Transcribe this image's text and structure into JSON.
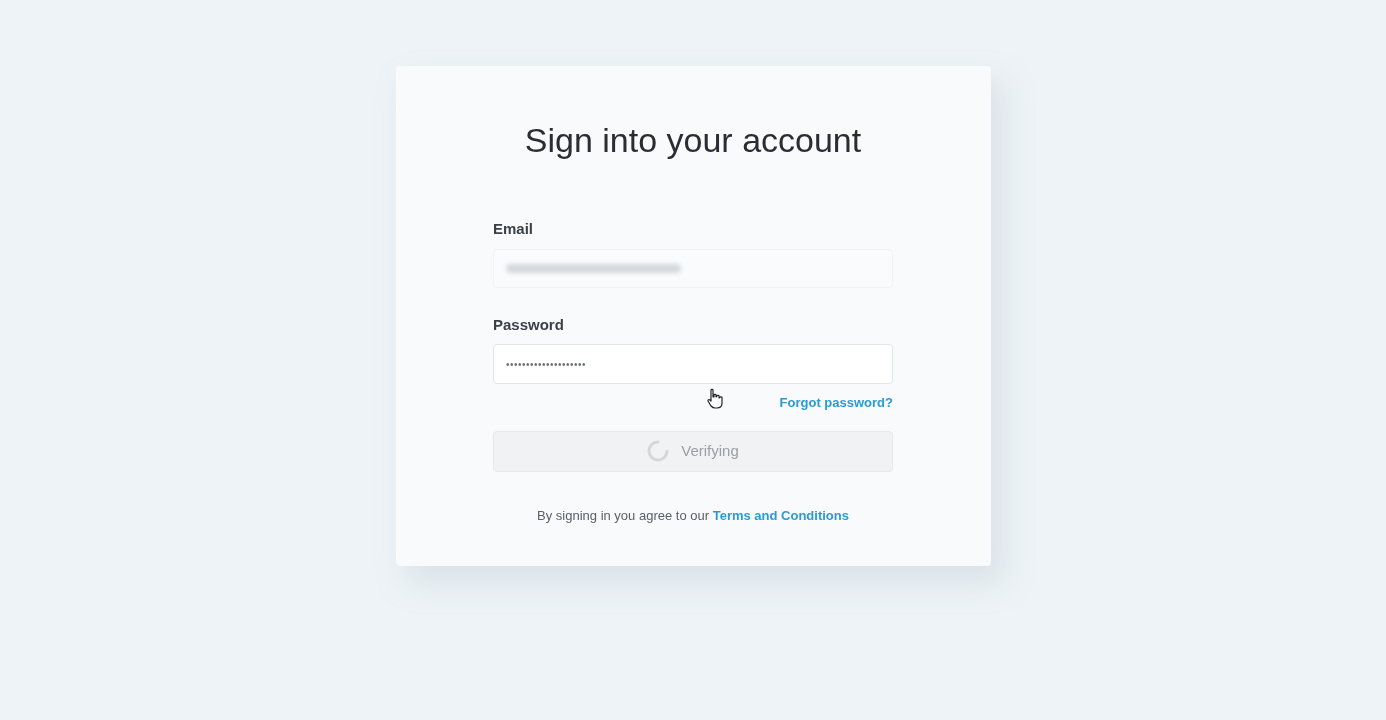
{
  "card": {
    "title": "Sign into your account",
    "email": {
      "label": "Email",
      "redacted": true
    },
    "password": {
      "label": "Password",
      "value": "••••••••••••••••••••"
    },
    "forgot_link": "Forgot password?",
    "submit": {
      "label": "Verifying",
      "loading": true,
      "disabled": true
    },
    "terms": {
      "text": "By signing in you agree to our",
      "link": "Terms and Conditions"
    }
  }
}
